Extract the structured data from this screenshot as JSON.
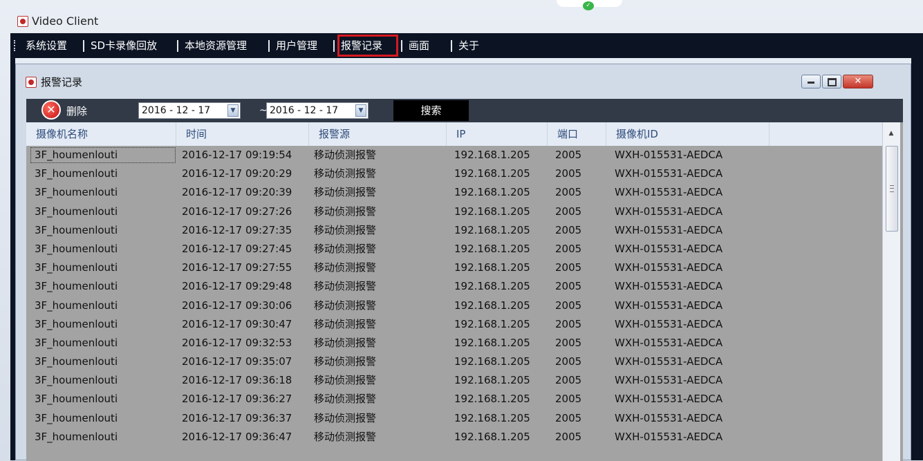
{
  "window": {
    "title": "Video Client"
  },
  "menu": {
    "items": [
      {
        "label": "系统设置"
      },
      {
        "label": "SD卡录像回放"
      },
      {
        "label": "本地资源管理"
      },
      {
        "label": "用户管理"
      },
      {
        "label": "报警记录",
        "highlighted": true
      },
      {
        "label": "画面"
      },
      {
        "label": "关于"
      }
    ]
  },
  "dialog": {
    "title": "报警记录",
    "toolbar": {
      "delete_label": "删除",
      "start_date": "2016 - 12 - 17",
      "range_sep": "~",
      "end_date": "2016 - 12 - 17",
      "search_label": "搜索"
    }
  },
  "table": {
    "columns": [
      "摄像机名称",
      "时间",
      "报警源",
      "IP",
      "端口",
      "摄像机ID"
    ],
    "rows": [
      [
        "3F_houmenlouti",
        "2016-12-17 09:19:54",
        "移动侦测报警",
        "192.168.1.205",
        "2005",
        "WXH-015531-AEDCA"
      ],
      [
        "3F_houmenlouti",
        "2016-12-17 09:20:29",
        "移动侦测报警",
        "192.168.1.205",
        "2005",
        "WXH-015531-AEDCA"
      ],
      [
        "3F_houmenlouti",
        "2016-12-17 09:20:39",
        "移动侦测报警",
        "192.168.1.205",
        "2005",
        "WXH-015531-AEDCA"
      ],
      [
        "3F_houmenlouti",
        "2016-12-17 09:27:26",
        "移动侦测报警",
        "192.168.1.205",
        "2005",
        "WXH-015531-AEDCA"
      ],
      [
        "3F_houmenlouti",
        "2016-12-17 09:27:35",
        "移动侦测报警",
        "192.168.1.205",
        "2005",
        "WXH-015531-AEDCA"
      ],
      [
        "3F_houmenlouti",
        "2016-12-17 09:27:45",
        "移动侦测报警",
        "192.168.1.205",
        "2005",
        "WXH-015531-AEDCA"
      ],
      [
        "3F_houmenlouti",
        "2016-12-17 09:27:55",
        "移动侦测报警",
        "192.168.1.205",
        "2005",
        "WXH-015531-AEDCA"
      ],
      [
        "3F_houmenlouti",
        "2016-12-17 09:29:48",
        "移动侦测报警",
        "192.168.1.205",
        "2005",
        "WXH-015531-AEDCA"
      ],
      [
        "3F_houmenlouti",
        "2016-12-17 09:30:06",
        "移动侦测报警",
        "192.168.1.205",
        "2005",
        "WXH-015531-AEDCA"
      ],
      [
        "3F_houmenlouti",
        "2016-12-17 09:30:47",
        "移动侦测报警",
        "192.168.1.205",
        "2005",
        "WXH-015531-AEDCA"
      ],
      [
        "3F_houmenlouti",
        "2016-12-17 09:32:53",
        "移动侦测报警",
        "192.168.1.205",
        "2005",
        "WXH-015531-AEDCA"
      ],
      [
        "3F_houmenlouti",
        "2016-12-17 09:35:07",
        "移动侦测报警",
        "192.168.1.205",
        "2005",
        "WXH-015531-AEDCA"
      ],
      [
        "3F_houmenlouti",
        "2016-12-17 09:36:18",
        "移动侦测报警",
        "192.168.1.205",
        "2005",
        "WXH-015531-AEDCA"
      ],
      [
        "3F_houmenlouti",
        "2016-12-17 09:36:27",
        "移动侦测报警",
        "192.168.1.205",
        "2005",
        "WXH-015531-AEDCA"
      ],
      [
        "3F_houmenlouti",
        "2016-12-17 09:36:37",
        "移动侦测报警",
        "192.168.1.205",
        "2005",
        "WXH-015531-AEDCA"
      ],
      [
        "3F_houmenlouti",
        "2016-12-17 09:36:47",
        "移动侦测报警",
        "192.168.1.205",
        "2005",
        "WXH-015531-AEDCA"
      ]
    ]
  },
  "colors": {
    "menubar_bg": "#0c1424",
    "highlight_border": "#d71920",
    "table_bg": "#a3a3a3",
    "header_text": "#2f4c7a"
  }
}
